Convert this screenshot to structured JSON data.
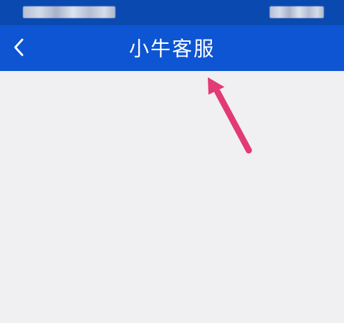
{
  "header": {
    "title": "小牛客服",
    "back_icon": "chevron-left-icon",
    "background": "#0d55d3"
  },
  "status_bar": {
    "background": "#0a49b0"
  },
  "content": {
    "background": "#f0eff1"
  },
  "annotation": {
    "color": "#e23a74"
  }
}
